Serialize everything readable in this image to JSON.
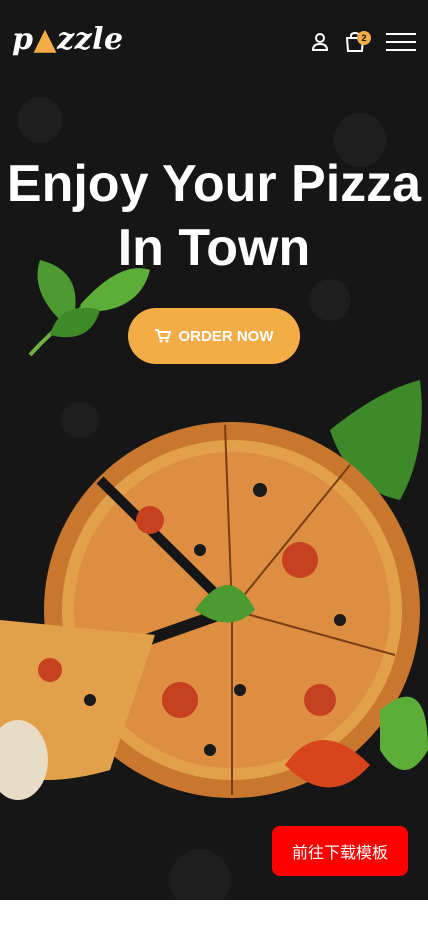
{
  "header": {
    "logo_start": "p",
    "logo_end": "zzle",
    "cart_count": "2",
    "icons": [
      "user-icon",
      "shopping-bag-icon",
      "hamburger-menu-icon"
    ]
  },
  "hero": {
    "headline": "Enjoy Your Pizza In Town",
    "order_button": "ORDER NOW",
    "order_icon": "cart-icon"
  },
  "download_button": "前往下载模板",
  "colors": {
    "background": "#161616",
    "accent": "#f4ad46",
    "download": "#ff0000"
  }
}
